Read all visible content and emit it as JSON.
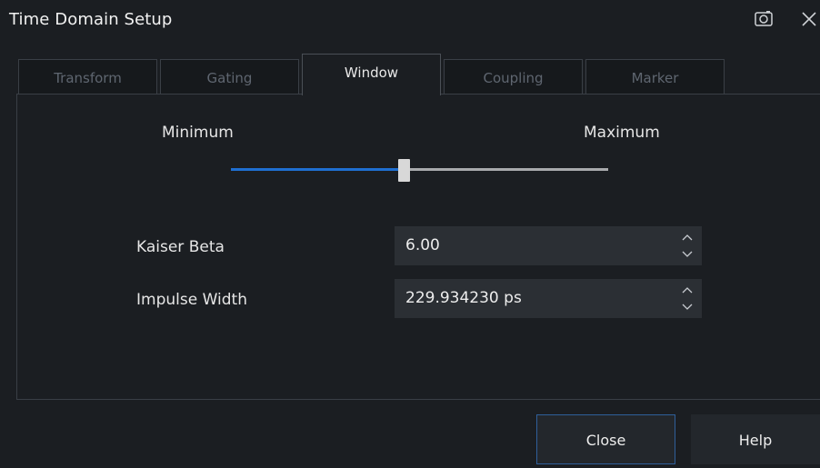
{
  "window": {
    "title": "Time Domain Setup"
  },
  "icons": {
    "camera": "camera-icon",
    "close": "close-icon"
  },
  "tabs": [
    {
      "label": "Transform",
      "active": false
    },
    {
      "label": "Gating",
      "active": false
    },
    {
      "label": "Window",
      "active": true
    },
    {
      "label": "Coupling",
      "active": false
    },
    {
      "label": "Marker",
      "active": false
    }
  ],
  "window_slider": {
    "min_label": "Minimum",
    "max_label": "Maximum",
    "level_fraction": 0.46
  },
  "fields": {
    "kaiser_beta": {
      "label": "Kaiser Beta",
      "value": "6.00"
    },
    "impulse_width": {
      "label": "Impulse Width",
      "value": "229.934230 ps"
    }
  },
  "buttons": {
    "close": "Close",
    "help": "Help"
  },
  "colors": {
    "accent": "#1f6fd1",
    "background": "#1b1e22",
    "field": "#2b2f34"
  }
}
